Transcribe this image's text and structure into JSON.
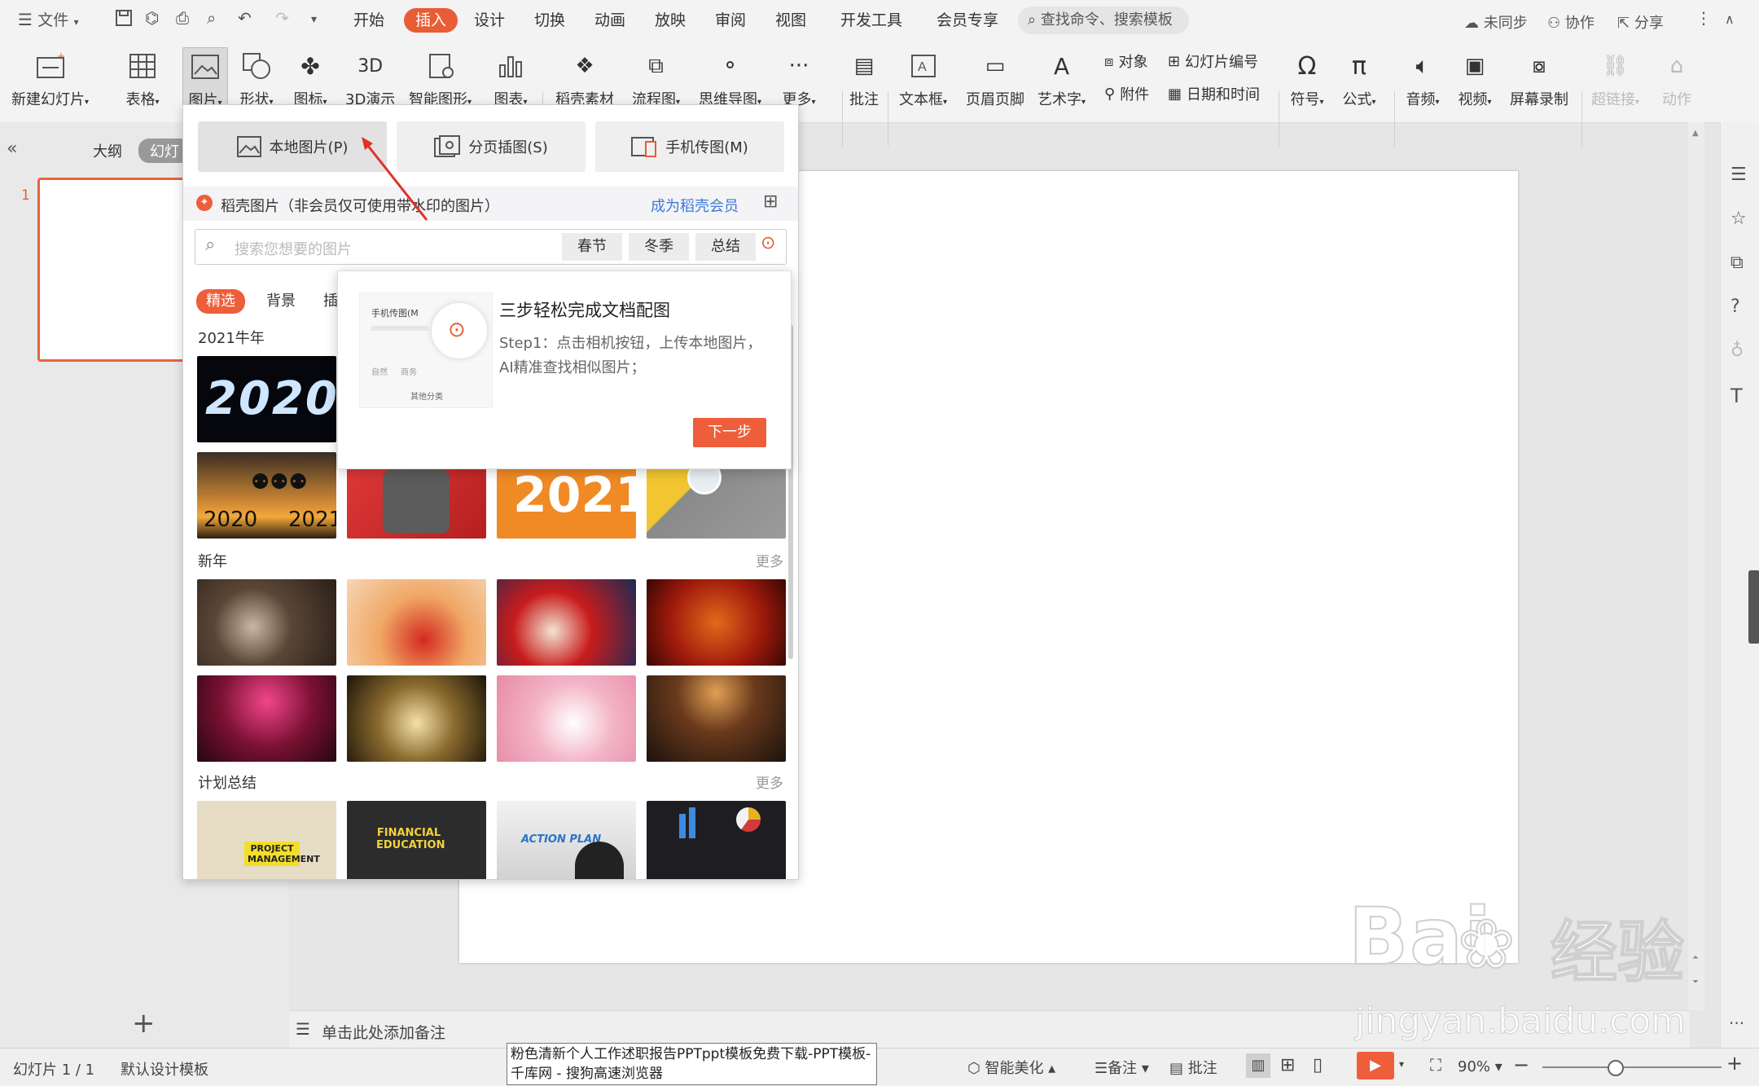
{
  "menubar": {
    "file": "文件",
    "tabs": [
      "开始",
      "插入",
      "设计",
      "切换",
      "动画",
      "放映",
      "审阅",
      "视图",
      "开发工具",
      "会员专享"
    ],
    "active_tab": "插入",
    "search": "查找命令、搜索模板",
    "right": {
      "sync": "未同步",
      "collab": "协作",
      "share": "分享"
    }
  },
  "ribbon": {
    "new_slide": "新建幻灯片",
    "table": "表格",
    "picture": "图片",
    "shape": "形状",
    "icon": "图标",
    "model3d": "3D演示",
    "smartart": "智能图形",
    "chart": "图表",
    "daoke": "稻壳素材",
    "flow": "流程图",
    "mindmap": "思维导图",
    "more": "更多",
    "comment": "批注",
    "textbox": "文本框",
    "header_footer": "页眉页脚",
    "wordart": "艺术字",
    "object": "对象",
    "slide_number": "幻灯片编号",
    "attachment": "附件",
    "datetime": "日期和时间",
    "symbol": "符号",
    "formula": "公式",
    "audio": "音频",
    "video": "视频",
    "screen_rec": "屏幕录制",
    "hyperlink": "超链接",
    "action": "动作"
  },
  "left_panel": {
    "outline": "大纲",
    "slides": "幻灯",
    "slide_index": "1"
  },
  "dropdown": {
    "local": "本地图片(P)",
    "paged": "分页插图(S)",
    "phone": "手机传图(M)",
    "daoke_label": "稻壳图片（非会员仅可使用带水印的图片）",
    "member_link": "成为稻壳会员",
    "search_placeholder": "搜索您想要的图片",
    "tags": [
      "春节",
      "冬季",
      "总结"
    ],
    "categories": [
      "精选",
      "背景",
      "插"
    ],
    "sections": [
      {
        "title": "2021牛年",
        "more": ""
      },
      {
        "title": "新年",
        "more": "更多"
      },
      {
        "title": "计划总结",
        "more": "更多"
      }
    ],
    "thumb_texts": {
      "y2020": "2020",
      "y2021": "2021",
      "jump_left": "2020",
      "jump_right": "2021",
      "project": "PROJECT MANAGEMENT",
      "finance": "FINANCIAL EDUCATION",
      "action": "ACTION PLAN"
    }
  },
  "tooltip": {
    "title": "三步轻松完成文档配图",
    "body": "Step1：点击相机按钮，上传本地图片，AI精准查找相似图片；",
    "next": "下一步",
    "mock_phone": "手机传图(M",
    "mock_nature": "自然",
    "mock_business": "商务",
    "mock_other": "其他分类"
  },
  "notes": {
    "placeholder": "单击此处添加备注"
  },
  "statusbar": {
    "slide_info": "幻灯片 1 / 1",
    "template": "默认设计模板",
    "beautify": "智能美化",
    "notes": "备注",
    "comment": "批注",
    "zoom": "90%"
  },
  "browser_tip": "粉色清新个人工作述职报告PPTppt模板免费下载-PPT模板-千库网 - 搜狗高速浏览器",
  "watermark": {
    "brand": "Bai",
    "brand2": "经验",
    "url": "jingyan.baidu.com"
  },
  "colors": {
    "accent": "#e85c36",
    "link": "#3d7bd8"
  }
}
